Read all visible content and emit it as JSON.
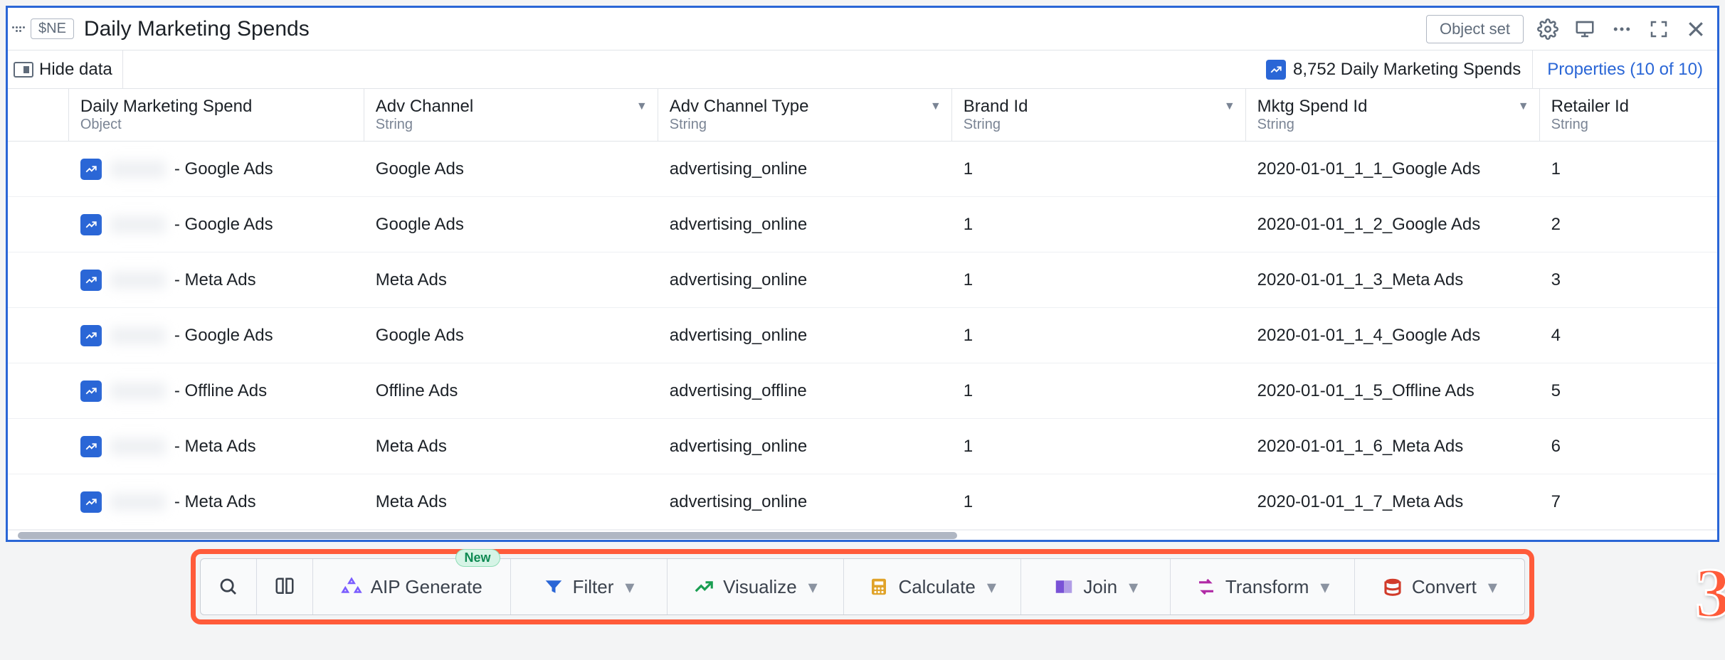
{
  "header": {
    "chip": "$NE",
    "title": "Daily Marketing Spends",
    "object_set_button": "Object set"
  },
  "subheader": {
    "hide_data": "Hide data",
    "count_text": "8,752 Daily Marketing Spends",
    "properties_link": "Properties (10 of 10)"
  },
  "columns": [
    {
      "label": "",
      "type": ""
    },
    {
      "label": "Daily Marketing Spend",
      "type": "Object"
    },
    {
      "label": "Adv Channel",
      "type": "String"
    },
    {
      "label": "Adv Channel Type",
      "type": "String"
    },
    {
      "label": "Brand Id",
      "type": "String"
    },
    {
      "label": "Mktg Spend Id",
      "type": "String"
    },
    {
      "label": "Retailer Id",
      "type": "String"
    }
  ],
  "rows": [
    {
      "name_suffix": " - Google Ads",
      "adv_channel": "Google Ads",
      "adv_channel_type": "advertising_online",
      "brand_id": "1",
      "mktg_spend_id": "2020-01-01_1_1_Google Ads",
      "retailer_id": "1"
    },
    {
      "name_suffix": " - Google Ads",
      "adv_channel": "Google Ads",
      "adv_channel_type": "advertising_online",
      "brand_id": "1",
      "mktg_spend_id": "2020-01-01_1_2_Google Ads",
      "retailer_id": "2"
    },
    {
      "name_suffix": " - Meta Ads",
      "adv_channel": "Meta Ads",
      "adv_channel_type": "advertising_online",
      "brand_id": "1",
      "mktg_spend_id": "2020-01-01_1_3_Meta Ads",
      "retailer_id": "3"
    },
    {
      "name_suffix": " - Google Ads",
      "adv_channel": "Google Ads",
      "adv_channel_type": "advertising_online",
      "brand_id": "1",
      "mktg_spend_id": "2020-01-01_1_4_Google Ads",
      "retailer_id": "4"
    },
    {
      "name_suffix": " - Offline Ads",
      "adv_channel": "Offline Ads",
      "adv_channel_type": "advertising_offline",
      "brand_id": "1",
      "mktg_spend_id": "2020-01-01_1_5_Offline Ads",
      "retailer_id": "5"
    },
    {
      "name_suffix": " - Meta Ads",
      "adv_channel": "Meta Ads",
      "adv_channel_type": "advertising_online",
      "brand_id": "1",
      "mktg_spend_id": "2020-01-01_1_6_Meta Ads",
      "retailer_id": "6"
    },
    {
      "name_suffix": " - Meta Ads",
      "adv_channel": "Meta Ads",
      "adv_channel_type": "advertising_online",
      "brand_id": "1",
      "mktg_spend_id": "2020-01-01_1_7_Meta Ads",
      "retailer_id": "7"
    }
  ],
  "toolbar": {
    "new_badge": "New",
    "aip_generate": "AIP Generate",
    "filter": "Filter",
    "visualize": "Visualize",
    "calculate": "Calculate",
    "join": "Join",
    "transform": "Transform",
    "convert": "Convert"
  },
  "annotation_number": "3"
}
